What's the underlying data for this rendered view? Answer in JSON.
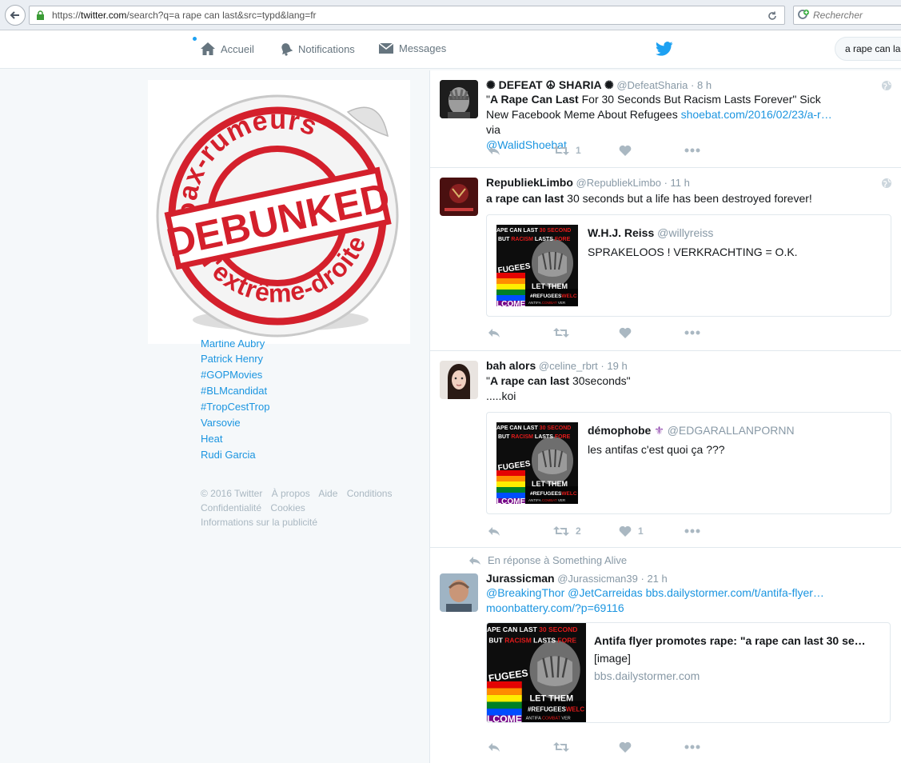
{
  "browser": {
    "url_prefix": "https://",
    "url_domain": "twitter.com",
    "url_path": "/search?q=a rape can last&src=typd&lang=fr",
    "search_placeholder": "Rechercher"
  },
  "nav": {
    "home": "Accueil",
    "notifications": "Notifications",
    "messages": "Messages",
    "search_value": "a rape can last"
  },
  "debunked": {
    "top": "Hoax-rumeurs",
    "center": "DEBUNKED",
    "bottom": "d'extrême-droite",
    "color": "#d4202c"
  },
  "trends": [
    "Martine Aubry",
    "Patrick Henry",
    "#GOPMovies",
    "#BLMcandidat",
    "#TropCestTrop",
    "Varsovie",
    "Heat",
    "Rudi Garcia"
  ],
  "footer": {
    "line1": [
      "© 2016 Twitter",
      "À propos",
      "Aide",
      "Conditions"
    ],
    "line2": [
      "Confidentialité",
      "Cookies"
    ],
    "line3": [
      "Informations sur la publicité"
    ]
  },
  "tweets": [
    {
      "name": "✺ DEFEAT ☮ SHARIA ✺",
      "handle": "@DefeatSharia",
      "time": "8 h",
      "text_pre": "\"",
      "text_bold": "A Rape Can Last",
      "text_post": " For 30 Seconds But Racism Lasts Forever\" Sick New Facebook Meme About Refugees ",
      "link": "shoebat.com/2016/02/23/a-r…",
      "via": " via",
      "mention": "@WalidShoebat",
      "retweets": "1",
      "likes": ""
    },
    {
      "name": "RepubliekLimbo",
      "handle": "@RepubliekLimbo",
      "time": "11 h",
      "text_bold": "a rape can last",
      "text_post": " 30 seconds but a life has been destroyed forever!",
      "quote_name": "W.H.J. Reiss",
      "quote_handle": "@willyreiss",
      "quote_text": "SPRAKELOOS ! VERKRACHTING = O.K."
    },
    {
      "name": "bah alors",
      "handle": "@celine_rbrt",
      "time": "19 h",
      "text_pre": "\"",
      "text_bold": "A rape can last",
      "text_post": " 30seconds\"",
      "text_line2": ".....koi",
      "quote_name": "démophobe",
      "quote_emoji": "⚜",
      "quote_handle": "@EDGARALLANPORNN",
      "quote_text": "les antifas c'est quoi ça ???",
      "retweets": "2",
      "likes": "1"
    },
    {
      "reply_context": "En réponse à Something Alive",
      "name": "Jurassicman",
      "handle": "@Jurassicman39",
      "time": "21 h",
      "mention1": "@BreakingThor",
      "mention2": "@JetCarreidas",
      "link1": "bbs.dailystormer.com/t/antifa-flyer…",
      "link2": "moonbattery.com/?p=69116",
      "card_title": "Antifa flyer promotes rape: \"a rape can last 30 se…",
      "card_desc": "[image]",
      "card_domain": "bbs.dailystormer.com"
    }
  ],
  "meme": {
    "line1a": "APE CAN LAST ",
    "line1b": "30 SECOND",
    "line2a": "BUT ",
    "line2b": "RACISM",
    "line2c": " LASTS ",
    "line2d": "FORE",
    "refugees": "FUGEES",
    "welcome": "LCOME",
    "let_them": "LET THEM",
    "hashtag": "#REFUGEES",
    "hashtag2": "WELC",
    "antifa": "ANTIFA",
    "antifa2": "COMBAT",
    "antifa3": "VER"
  },
  "colors": {
    "link": "#1b95e0",
    "twitter_blue": "#1da1f2",
    "meme_red": "#e21b1b"
  }
}
